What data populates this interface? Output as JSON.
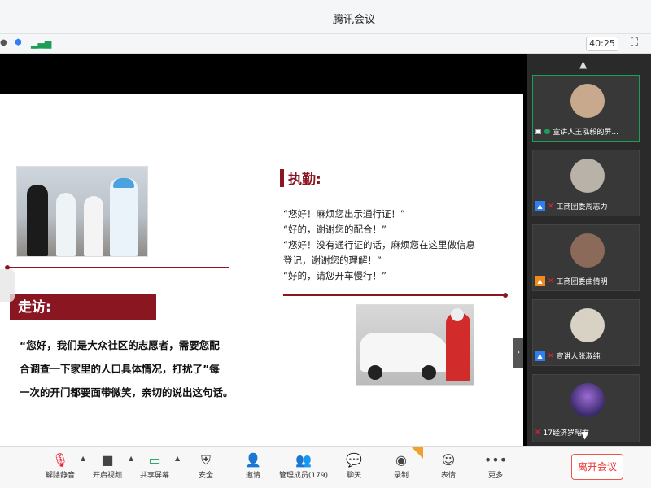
{
  "window": {
    "title": "腾讯会议"
  },
  "infobar": {
    "timer": "40:25"
  },
  "slide": {
    "section_left_title": "走访:",
    "left_paragraph": [
      "“您好，我们是大众社区的志愿者，需要您配",
      "合调查一下家里的人口具体情况，打扰了”每",
      "一次的开门都要面带微笑，亲切的说出这句话。"
    ],
    "section_right_title": "执勤:",
    "right_quotes": [
      "“您好！麻烦您出示通行证！”",
      "“好的，谢谢您的配合！”",
      "“您好！没有通行证的话，麻烦您在这里做信息",
      "登记，谢谢您的理解！”",
      "“好的，请您开车慢行！”"
    ]
  },
  "participants": [
    {
      "name": "宣讲人王泓毅的屏...",
      "badge": "screen-share-icon"
    },
    {
      "name": "工商团委周志力",
      "badge": "user-blue"
    },
    {
      "name": "工商团委曲倩明",
      "badge": "user-orange"
    },
    {
      "name": "宣讲人张淑纯",
      "badge": "user-blue"
    },
    {
      "name": "17经济罗昭君",
      "badge": "none"
    }
  ],
  "toolbar": {
    "unmute": "解除静音",
    "video": "开启视频",
    "share": "共享屏幕",
    "security": "安全",
    "invite": "邀请",
    "members": "管理成员(179)",
    "chat": "聊天",
    "record": "录制",
    "reactions": "表情",
    "more": "更多",
    "leave": "离开会议"
  },
  "colors": {
    "accent_red": "#8a1622",
    "active_green": "#1e9d57",
    "share_blue": "#2e7ff0"
  }
}
